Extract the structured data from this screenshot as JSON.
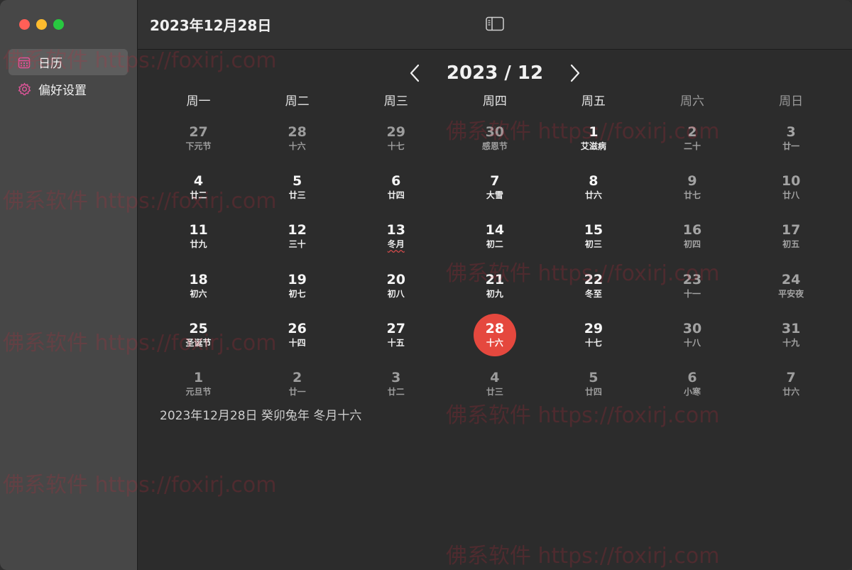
{
  "window": {
    "title": "2023年12月28日"
  },
  "sidebar": {
    "items": [
      {
        "label": "日历",
        "icon": "calendar-icon",
        "active": true
      },
      {
        "label": "偏好设置",
        "icon": "gear-icon",
        "active": false
      }
    ]
  },
  "calendar": {
    "month_title": "2023 / 12",
    "weekdays": [
      "周一",
      "周二",
      "周三",
      "周四",
      "周五",
      "周六",
      "周日"
    ],
    "weeks": [
      [
        {
          "d": "27",
          "l": "下元节",
          "dim": true
        },
        {
          "d": "28",
          "l": "十六",
          "dim": true
        },
        {
          "d": "29",
          "l": "十七",
          "dim": true
        },
        {
          "d": "30",
          "l": "感恩节",
          "dim": true
        },
        {
          "d": "1",
          "l": "艾滋病"
        },
        {
          "d": "2",
          "l": "二十"
        },
        {
          "d": "3",
          "l": "廿一"
        }
      ],
      [
        {
          "d": "4",
          "l": "廿二"
        },
        {
          "d": "5",
          "l": "廿三"
        },
        {
          "d": "6",
          "l": "廿四"
        },
        {
          "d": "7",
          "l": "大雪"
        },
        {
          "d": "8",
          "l": "廿六"
        },
        {
          "d": "9",
          "l": "廿七"
        },
        {
          "d": "10",
          "l": "廿八"
        }
      ],
      [
        {
          "d": "11",
          "l": "廿九"
        },
        {
          "d": "12",
          "l": "三十"
        },
        {
          "d": "13",
          "l": "冬月",
          "underline": true
        },
        {
          "d": "14",
          "l": "初二"
        },
        {
          "d": "15",
          "l": "初三"
        },
        {
          "d": "16",
          "l": "初四"
        },
        {
          "d": "17",
          "l": "初五"
        }
      ],
      [
        {
          "d": "18",
          "l": "初六"
        },
        {
          "d": "19",
          "l": "初七"
        },
        {
          "d": "20",
          "l": "初八"
        },
        {
          "d": "21",
          "l": "初九"
        },
        {
          "d": "22",
          "l": "冬至"
        },
        {
          "d": "23",
          "l": "十一"
        },
        {
          "d": "24",
          "l": "平安夜"
        }
      ],
      [
        {
          "d": "25",
          "l": "圣诞节"
        },
        {
          "d": "26",
          "l": "十四"
        },
        {
          "d": "27",
          "l": "十五"
        },
        {
          "d": "28",
          "l": "十六",
          "today": true
        },
        {
          "d": "29",
          "l": "十七"
        },
        {
          "d": "30",
          "l": "十八"
        },
        {
          "d": "31",
          "l": "十九"
        }
      ],
      [
        {
          "d": "1",
          "l": "元旦节",
          "dim": true
        },
        {
          "d": "2",
          "l": "廿一",
          "dim": true
        },
        {
          "d": "3",
          "l": "廿二",
          "dim": true
        },
        {
          "d": "4",
          "l": "廿三",
          "dim": true
        },
        {
          "d": "5",
          "l": "廿四",
          "dim": true
        },
        {
          "d": "6",
          "l": "小寒",
          "dim": true
        },
        {
          "d": "7",
          "l": "廿六",
          "dim": true
        }
      ]
    ],
    "selected_info": "2023年12月28日 癸卯兔年 冬月十六"
  },
  "watermark_text": "佛系软件 https://foxirj.com",
  "colors": {
    "today": "#e5483e",
    "accent_pink": "#e0559a"
  }
}
